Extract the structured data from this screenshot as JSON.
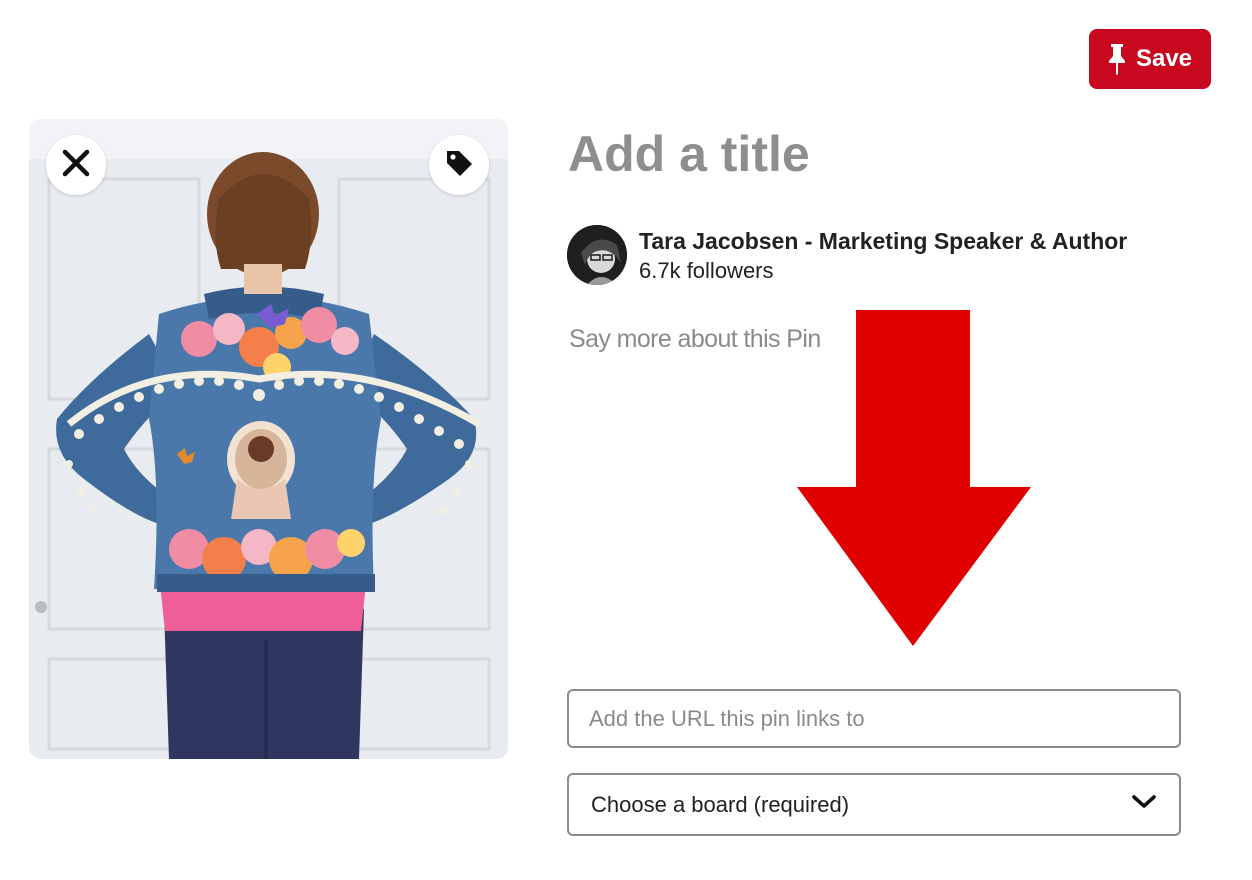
{
  "header": {
    "save_label": "Save",
    "save_icon": "pushpin-icon",
    "accent_color": "#c8081f"
  },
  "pin_image": {
    "close_icon": "close-icon",
    "tag_icon": "tag-icon"
  },
  "pin": {
    "title_placeholder": "Add a title",
    "description_placeholder": "Say more about this Pin"
  },
  "author": {
    "name": "Tara Jacobsen - Marketing Speaker & Author",
    "followers": "6.7k followers"
  },
  "form": {
    "url_placeholder": "Add the URL this pin links to",
    "board_label": "Choose a board (required)",
    "board_icon": "chevron-down-icon"
  },
  "annotation": {
    "arrow_color": "#e00000",
    "arrow_icon": "down-arrow-icon"
  }
}
